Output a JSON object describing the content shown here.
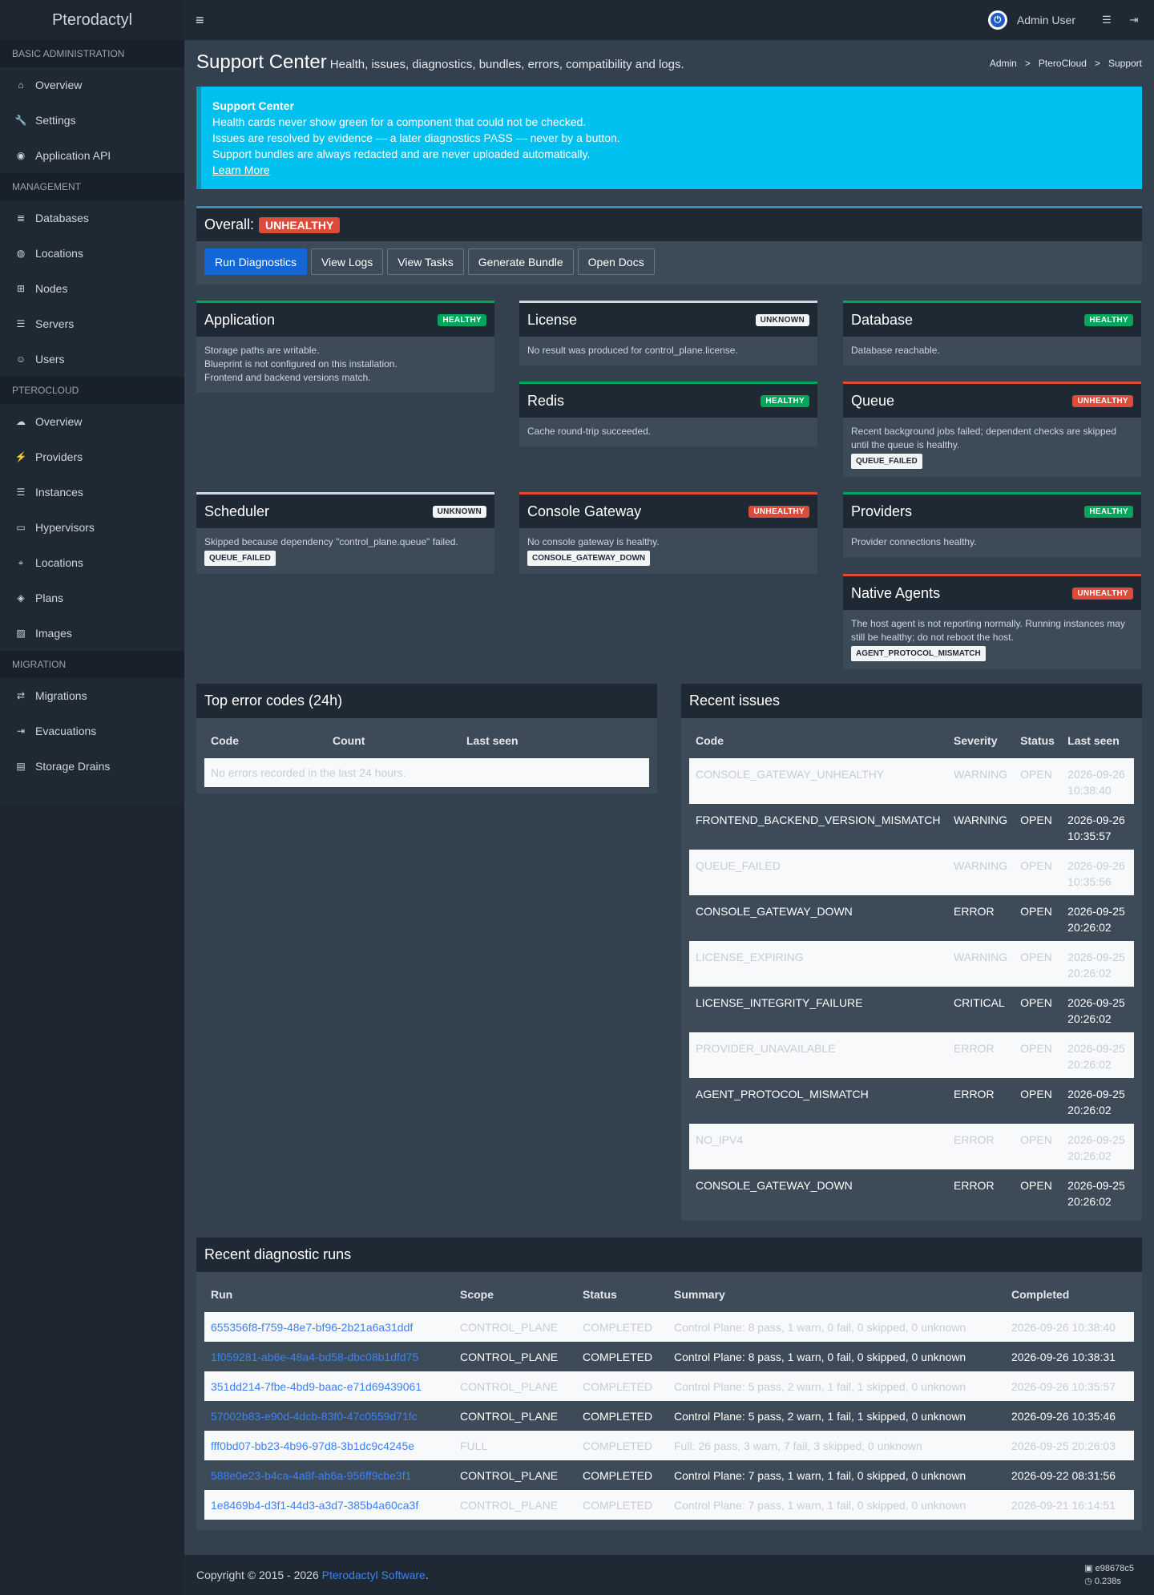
{
  "header": {
    "brand": "Pterodactyl",
    "menu_icon": "≡",
    "user_name": "Admin User"
  },
  "sidebar": {
    "sections": [
      {
        "title": "BASIC ADMINISTRATION",
        "items": [
          {
            "label": "Overview",
            "icon": "home-icon"
          },
          {
            "label": "Settings",
            "icon": "wrench-icon"
          },
          {
            "label": "Application API",
            "icon": "gamepad-icon"
          }
        ]
      },
      {
        "title": "MANAGEMENT",
        "items": [
          {
            "label": "Databases",
            "icon": "database-icon"
          },
          {
            "label": "Locations",
            "icon": "globe-icon"
          },
          {
            "label": "Nodes",
            "icon": "sitemap-icon"
          },
          {
            "label": "Servers",
            "icon": "server-icon"
          },
          {
            "label": "Users",
            "icon": "users-icon"
          }
        ]
      },
      {
        "title": "PTEROCLOUD",
        "items": [
          {
            "label": "Overview",
            "icon": "cloud-icon"
          },
          {
            "label": "Providers",
            "icon": "plug-icon"
          },
          {
            "label": "Instances",
            "icon": "server-icon"
          },
          {
            "label": "Hypervisors",
            "icon": "desktop-icon"
          },
          {
            "label": "Locations",
            "icon": "map-pin-icon"
          },
          {
            "label": "Plans",
            "icon": "cube-icon"
          },
          {
            "label": "Images",
            "icon": "image-icon"
          }
        ]
      },
      {
        "title": "MIGRATION",
        "items": [
          {
            "label": "Migrations",
            "icon": "exchange-icon"
          },
          {
            "label": "Evacuations",
            "icon": "sign-out-icon"
          },
          {
            "label": "Storage Drains",
            "icon": "hdd-icon"
          }
        ]
      }
    ]
  },
  "page": {
    "title": "Support Center",
    "subtitle": "Health, issues, diagnostics, bundles, errors, compatibility and logs.",
    "breadcrumb": [
      "Admin",
      "PteroCloud",
      "Support"
    ]
  },
  "callout": {
    "title": "Support Center",
    "lines": [
      "Health cards never show green for a component that could not be checked.",
      "Issues are resolved by evidence — a later diagnostics PASS — never by a button.",
      "Support bundles are always redacted and are never uploaded automatically."
    ],
    "link": "Learn More"
  },
  "overall": {
    "label": "Overall:",
    "status": "UNHEALTHY",
    "buttons": [
      "Run Diagnostics",
      "View Logs",
      "View Tasks",
      "Generate Bundle",
      "Open Docs"
    ]
  },
  "cards": {
    "application": {
      "title": "Application",
      "status": "HEALTHY",
      "lines": [
        "Storage paths are writable.",
        "Blueprint is not configured on this installation.",
        "Frontend and backend versions match."
      ]
    },
    "license": {
      "title": "License",
      "status": "UNKNOWN",
      "lines": [
        "No result was produced for control_plane.license."
      ]
    },
    "database": {
      "title": "Database",
      "status": "HEALTHY",
      "lines": [
        "Database reachable."
      ]
    },
    "redis": {
      "title": "Redis",
      "status": "HEALTHY",
      "lines": [
        "Cache round-trip succeeded."
      ]
    },
    "queue": {
      "title": "Queue",
      "status": "UNHEALTHY",
      "lines": [
        "Recent background jobs failed; dependent checks are skipped until the queue is healthy."
      ],
      "tag": "QUEUE_FAILED"
    },
    "scheduler": {
      "title": "Scheduler",
      "status": "UNKNOWN",
      "lines": [
        "Skipped because dependency \"control_plane.queue\" failed."
      ],
      "tag": "QUEUE_FAILED"
    },
    "console_gateway": {
      "title": "Console Gateway",
      "status": "UNHEALTHY",
      "lines": [
        "No console gateway is healthy."
      ],
      "tag": "CONSOLE_GATEWAY_DOWN"
    },
    "providers": {
      "title": "Providers",
      "status": "HEALTHY",
      "lines": [
        "Provider connections healthy."
      ]
    },
    "native_agents": {
      "title": "Native Agents",
      "status": "UNHEALTHY",
      "lines": [
        "The host agent is not reporting normally. Running instances may still be healthy; do not reboot the host."
      ],
      "tag": "AGENT_PROTOCOL_MISMATCH"
    }
  },
  "error_codes": {
    "title": "Top error codes (24h)",
    "columns": [
      "Code",
      "Count",
      "Last seen"
    ],
    "empty": "No errors recorded in the last 24 hours."
  },
  "issues": {
    "title": "Recent issues",
    "columns": [
      "Code",
      "Severity",
      "Status",
      "Last seen"
    ],
    "rows": [
      {
        "code": "CONSOLE_GATEWAY_UNHEALTHY",
        "severity": "WARNING",
        "status": "OPEN",
        "date": "2026-09-26",
        "time": "10:38:40"
      },
      {
        "code": "FRONTEND_BACKEND_VERSION_MISMATCH",
        "severity": "WARNING",
        "status": "OPEN",
        "date": "2026-09-26",
        "time": "10:35:57"
      },
      {
        "code": "QUEUE_FAILED",
        "severity": "WARNING",
        "status": "OPEN",
        "date": "2026-09-26",
        "time": "10:35:56"
      },
      {
        "code": "CONSOLE_GATEWAY_DOWN",
        "severity": "ERROR",
        "status": "OPEN",
        "date": "2026-09-25",
        "time": "20:26:02"
      },
      {
        "code": "LICENSE_EXPIRING",
        "severity": "WARNING",
        "status": "OPEN",
        "date": "2026-09-25",
        "time": "20:26:02"
      },
      {
        "code": "LICENSE_INTEGRITY_FAILURE",
        "severity": "CRITICAL",
        "status": "OPEN",
        "date": "2026-09-25",
        "time": "20:26:02"
      },
      {
        "code": "PROVIDER_UNAVAILABLE",
        "severity": "ERROR",
        "status": "OPEN",
        "date": "2026-09-25",
        "time": "20:26:02"
      },
      {
        "code": "AGENT_PROTOCOL_MISMATCH",
        "severity": "ERROR",
        "status": "OPEN",
        "date": "2026-09-25",
        "time": "20:26:02"
      },
      {
        "code": "NO_IPV4",
        "severity": "ERROR",
        "status": "OPEN",
        "date": "2026-09-25",
        "time": "20:26:02"
      },
      {
        "code": "CONSOLE_GATEWAY_DOWN",
        "severity": "ERROR",
        "status": "OPEN",
        "date": "2026-09-25",
        "time": "20:26:02"
      }
    ]
  },
  "runs": {
    "title": "Recent diagnostic runs",
    "columns": [
      "Run",
      "Scope",
      "Status",
      "Summary",
      "Completed"
    ],
    "rows": [
      {
        "run": "655356f8-f759-48e7-bf96-2b21a6a31ddf",
        "scope": "CONTROL_PLANE",
        "status": "COMPLETED",
        "summary": "Control Plane: 8 pass, 1 warn, 0 fail, 0 skipped, 0 unknown",
        "completed": "2026-09-26 10:38:40"
      },
      {
        "run": "1f059281-ab6e-48a4-bd58-dbc08b1dfd75",
        "scope": "CONTROL_PLANE",
        "status": "COMPLETED",
        "summary": "Control Plane: 8 pass, 1 warn, 0 fail, 0 skipped, 0 unknown",
        "completed": "2026-09-26 10:38:31"
      },
      {
        "run": "351dd214-7fbe-4bd9-baac-e71d69439061",
        "scope": "CONTROL_PLANE",
        "status": "COMPLETED",
        "summary": "Control Plane: 5 pass, 2 warn, 1 fail, 1 skipped, 0 unknown",
        "completed": "2026-09-26 10:35:57"
      },
      {
        "run": "57002b83-e90d-4dcb-83f0-47c0559d71fc",
        "scope": "CONTROL_PLANE",
        "status": "COMPLETED",
        "summary": "Control Plane: 5 pass, 2 warn, 1 fail, 1 skipped, 0 unknown",
        "completed": "2026-09-26 10:35:46"
      },
      {
        "run": "fff0bd07-bb23-4b96-97d8-3b1dc9c4245e",
        "scope": "FULL",
        "status": "COMPLETED",
        "summary": "Full: 26 pass, 3 warn, 7 fail, 3 skipped, 0 unknown",
        "completed": "2026-09-25 20:26:03"
      },
      {
        "run": "588e0e23-b4ca-4a8f-ab6a-956ff9cbe3f1",
        "scope": "CONTROL_PLANE",
        "status": "COMPLETED",
        "summary": "Control Plane: 7 pass, 1 warn, 1 fail, 0 skipped, 0 unknown",
        "completed": "2026-09-22 08:31:56"
      },
      {
        "run": "1e8469b4-d3f1-44d3-a3d7-385b4a60ca3f",
        "scope": "CONTROL_PLANE",
        "status": "COMPLETED",
        "summary": "Control Plane: 7 pass, 1 warn, 1 fail, 0 skipped, 0 unknown",
        "completed": "2026-09-21 16:14:51"
      }
    ]
  },
  "footer": {
    "copyright": "Copyright © 2015 - 2026 ",
    "company": "Pterodactyl Software",
    "period": ".",
    "version": "e98678c5",
    "time": "0.238s"
  },
  "colors": {
    "healthy": "#00a65a",
    "unhealthy": "#dd4b39",
    "info": "#00c0ef",
    "primary": "#1266d6"
  }
}
